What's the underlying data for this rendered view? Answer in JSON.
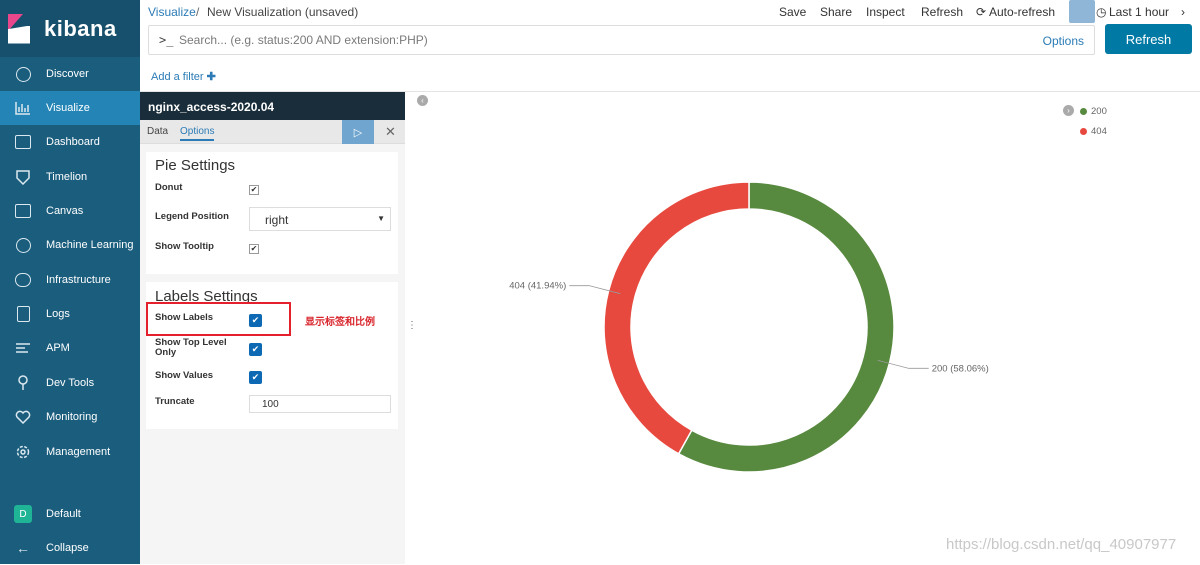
{
  "brand": {
    "name": "kibana"
  },
  "sidebar": {
    "items": [
      {
        "label": "Discover",
        "icon": "compass-icon"
      },
      {
        "label": "Visualize",
        "icon": "chart-icon",
        "active": true
      },
      {
        "label": "Dashboard",
        "icon": "dashboard-icon"
      },
      {
        "label": "Timelion",
        "icon": "shield-icon"
      },
      {
        "label": "Canvas",
        "icon": "canvas-icon"
      },
      {
        "label": "Machine Learning",
        "icon": "ml-icon"
      },
      {
        "label": "Infrastructure",
        "icon": "cloud-icon"
      },
      {
        "label": "Logs",
        "icon": "logs-icon"
      },
      {
        "label": "APM",
        "icon": "apm-icon"
      },
      {
        "label": "Dev Tools",
        "icon": "wrench-icon"
      },
      {
        "label": "Monitoring",
        "icon": "heartbeat-icon"
      },
      {
        "label": "Management",
        "icon": "gear-icon"
      }
    ],
    "space": {
      "badge": "D",
      "label": "Default"
    },
    "collapse_label": "Collapse"
  },
  "topbar": {
    "breadcrumb_link": "Visualize",
    "breadcrumb_sep": "/",
    "breadcrumb_current": "New Visualization (unsaved)",
    "save": "Save",
    "share": "Share",
    "inspect": "Inspect",
    "refresh": "Refresh",
    "auto_refresh": "Auto-refresh",
    "time_range": "Last 1 hour"
  },
  "search": {
    "prompt": ">_",
    "placeholder": "Search... (e.g. status:200 AND extension:PHP)",
    "options_label": "Options",
    "refresh_button": "Refresh"
  },
  "filter": {
    "add_filter": "Add a filter"
  },
  "editor": {
    "index_pattern": "nginx_access-2020.04",
    "tabs": [
      "Data",
      "Options"
    ],
    "active_tab": "Options",
    "pie_settings": {
      "title": "Pie Settings",
      "donut_label": "Donut",
      "donut": true,
      "legend_position_label": "Legend Position",
      "legend_position": "right",
      "show_tooltip_label": "Show Tooltip",
      "show_tooltip": true
    },
    "labels_settings": {
      "title": "Labels Settings",
      "show_labels_label": "Show Labels",
      "show_labels": true,
      "show_top_level_label": "Show Top Level Only",
      "show_top_level": true,
      "show_values_label": "Show Values",
      "show_values": true,
      "truncate_label": "Truncate",
      "truncate": "100"
    },
    "annotation": "显示标签和比例"
  },
  "chart_data": {
    "type": "pie",
    "donut": true,
    "slices": [
      {
        "label": "200",
        "value": 58.06,
        "color": "#57893e",
        "data_label": "200 (58.06%)"
      },
      {
        "label": "404",
        "value": 41.94,
        "color": "#e7493e",
        "data_label": "404 (41.94%)"
      }
    ],
    "legend": {
      "position": "top-right",
      "entries": [
        "200",
        "404"
      ]
    }
  },
  "watermark": "https://blog.csdn.net/qq_40907977"
}
